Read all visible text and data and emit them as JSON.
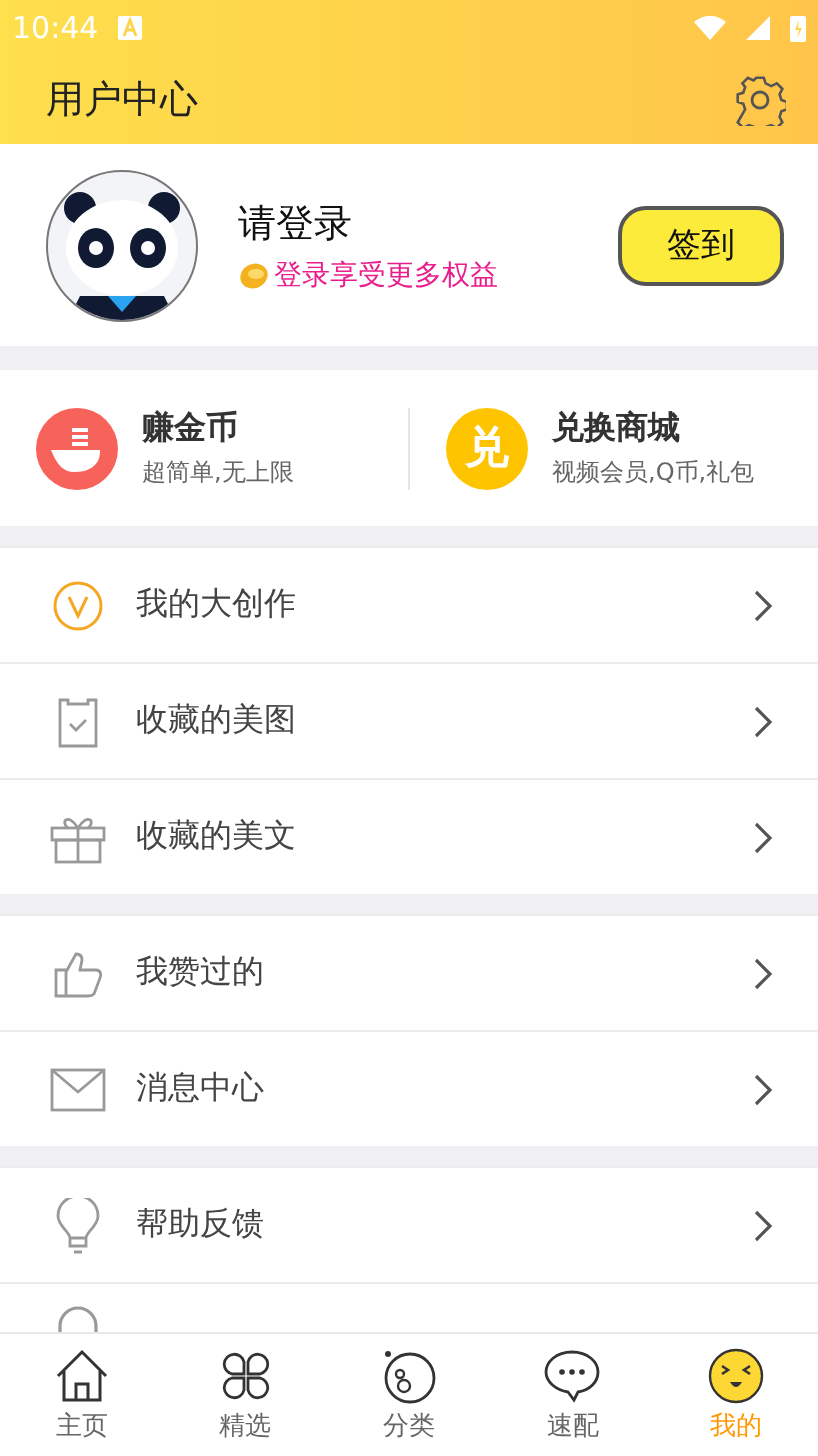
{
  "status_bar": {
    "time": "10:44"
  },
  "header": {
    "title": "用户中心"
  },
  "profile": {
    "name": "请登录",
    "subtitle": "登录享受更多权益",
    "checkin_button": "签到"
  },
  "features": [
    {
      "kind": "coins",
      "title": "赚金币",
      "subtitle": "超简单,无上限"
    },
    {
      "kind": "store",
      "badge": "兑",
      "title": "兑换商城",
      "subtitle": "视频会员,Q币,礼包"
    }
  ],
  "menu_groups": [
    [
      {
        "kind": "create",
        "label": "我的大创作"
      },
      {
        "kind": "images",
        "label": "收藏的美图"
      },
      {
        "kind": "articles",
        "label": "收藏的美文"
      }
    ],
    [
      {
        "kind": "likes",
        "label": "我赞过的"
      },
      {
        "kind": "messages",
        "label": "消息中心"
      }
    ],
    [
      {
        "kind": "help",
        "label": "帮助反馈"
      },
      {
        "kind": "group"
      }
    ]
  ],
  "tab_bar": [
    {
      "kind": "home",
      "label": "主页",
      "selected": false
    },
    {
      "kind": "featured",
      "label": "精选",
      "selected": false
    },
    {
      "kind": "category",
      "label": "分类",
      "selected": false
    },
    {
      "kind": "match",
      "label": "速配",
      "selected": false
    },
    {
      "kind": "mine",
      "label": "我的",
      "selected": true
    }
  ]
}
